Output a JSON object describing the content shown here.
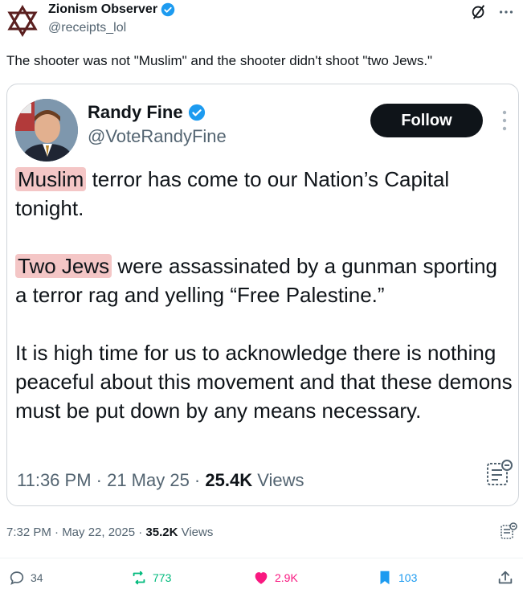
{
  "author": {
    "name": "Zionism Observer",
    "handle": "@receipts_lol"
  },
  "tweet": {
    "text": "The shooter was not \"Muslim\" and the shooter didn't shoot \"two Jews.\""
  },
  "quote": {
    "name": "Randy Fine",
    "handle": "@VoteRandyFine",
    "follow_label": "Follow",
    "p1_hl": "Muslim",
    "p1_rest": " terror has come to our Nation’s Capital tonight.",
    "p2_hl": "Two Jews",
    "p2_rest": " were assassinated by a gunman sporting a terror rag and yelling “Free Palestine.”",
    "p3": "It is high time for us to acknowledge there is nothing peaceful about this movement and that these demons must be put down by any means necessary.",
    "time": "11:36 PM · 21 May 25 · ",
    "views_count": "25.4K",
    "views_label": " Views"
  },
  "meta": {
    "time": "7:32 PM · May 22, 2025 · ",
    "views_count": "35.2K",
    "views_label": " Views"
  },
  "actions": {
    "replies": "34",
    "reposts": "773",
    "likes": "2.9K",
    "bookmarks": "103"
  },
  "icons": {
    "logo": "star-of-david-logo-icon",
    "verified": "verified-badge-icon",
    "grok": "grok-icon",
    "more": "more-horizontal-icon",
    "reply": "reply-icon",
    "repost": "repost-icon",
    "like": "heart-icon",
    "bookmark": "bookmark-icon",
    "share": "share-icon",
    "summary": "summary-icon"
  },
  "colors": {
    "highlight": "#f4c6c6",
    "verified": "#1d9bf0",
    "repost": "#00ba7c",
    "like": "#f91880"
  }
}
